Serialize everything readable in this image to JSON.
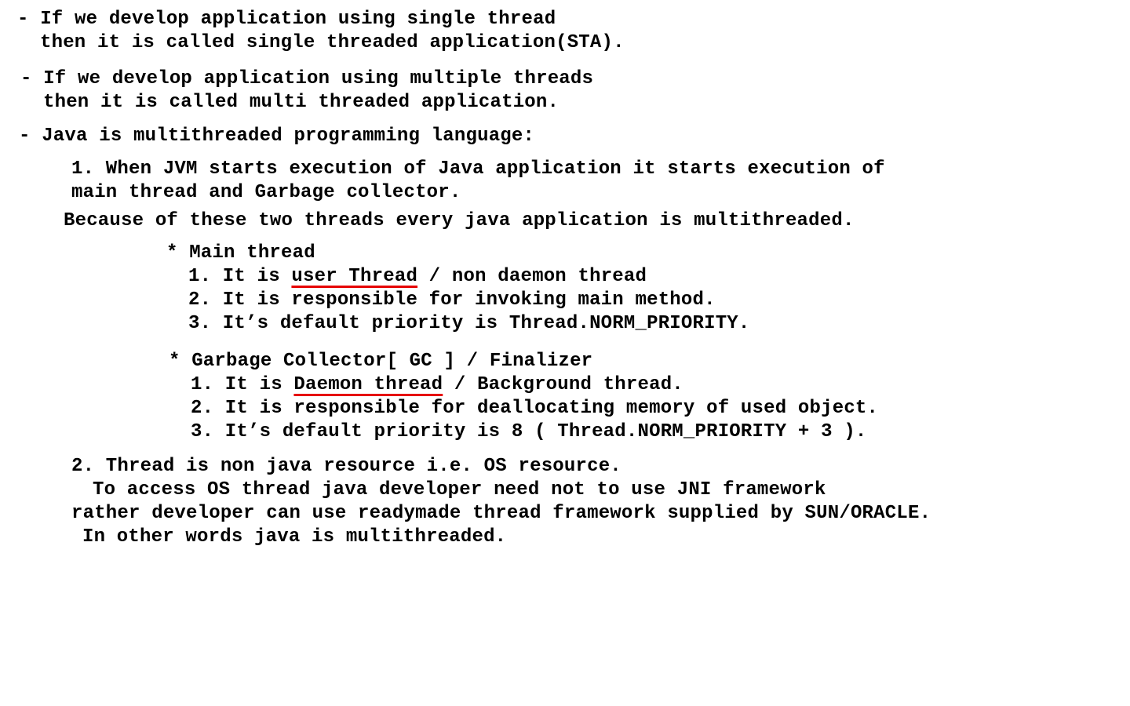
{
  "sta": {
    "line1": "- If we develop application using single thread",
    "line2": "then it is called single threaded application(STA)."
  },
  "mta": {
    "line1": "- If we develop application using multiple threads",
    "line2": "then it is called multi threaded application."
  },
  "java": {
    "heading": "- Java is multithreaded programming language:",
    "point1": {
      "line1": "1. When JVM starts execution of Java application it starts execution of",
      "line2": "main thread and Garbage collector.",
      "line3": "Because of these two threads every java application is multithreaded."
    },
    "main_thread": {
      "title": "* Main thread",
      "item1_prefix": "1. It is ",
      "item1_underlined": "user Thread",
      "item1_suffix": " / non daemon thread",
      "item2": "2. It is responsible for invoking main method.",
      "item3": "3. It’s default priority is Thread.NORM_PRIORITY."
    },
    "gc": {
      "title": "* Garbage Collector[ GC ] / Finalizer",
      "item1_prefix": "1. It is ",
      "item1_underlined": "Daemon thread",
      "item1_suffix": " / Background thread.",
      "item2": "2. It is responsible for deallocating memory of used object.",
      "item3": "3. It’s default priority is 8 ( Thread.NORM_PRIORITY + 3 )."
    },
    "point2": {
      "line1": "2. Thread is non java resource i.e. OS resource.",
      "line2": "To access OS thread java developer need not to use JNI framework",
      "line3": "rather developer can use readymade thread framework supplied by SUN/ORACLE.",
      "line4": "In other words java is multithreaded."
    }
  },
  "colors": {
    "text": "#000000",
    "underline": "#e60000",
    "background": "#ffffff"
  }
}
